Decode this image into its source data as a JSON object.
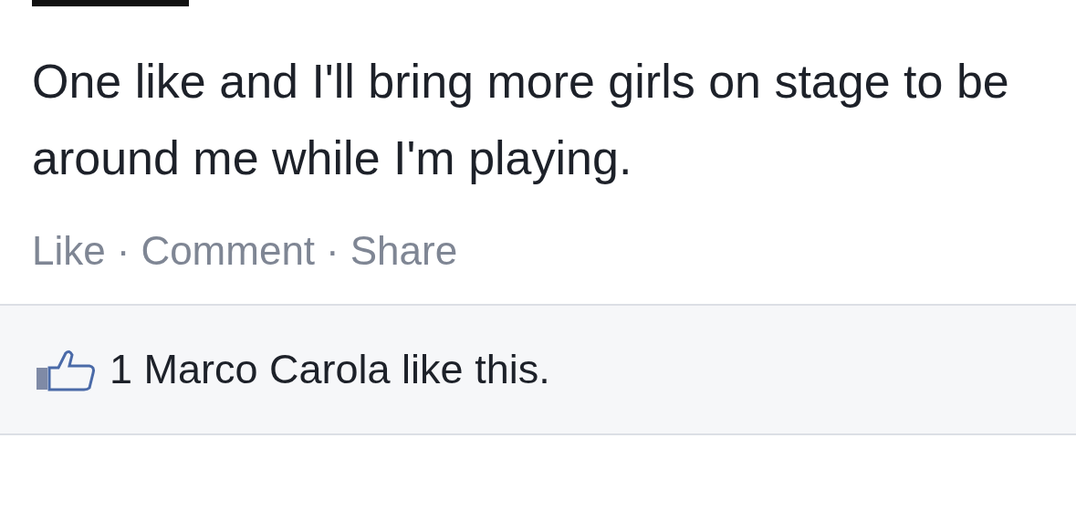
{
  "post": {
    "text": "One like and I'll bring more girls on stage to be around me while I'm playing.",
    "actions": [
      {
        "label": "Like"
      },
      {
        "label": "Comment"
      },
      {
        "label": "Share"
      }
    ],
    "action_separator": "·",
    "likes": {
      "text": "1 Marco Carola like this."
    }
  }
}
